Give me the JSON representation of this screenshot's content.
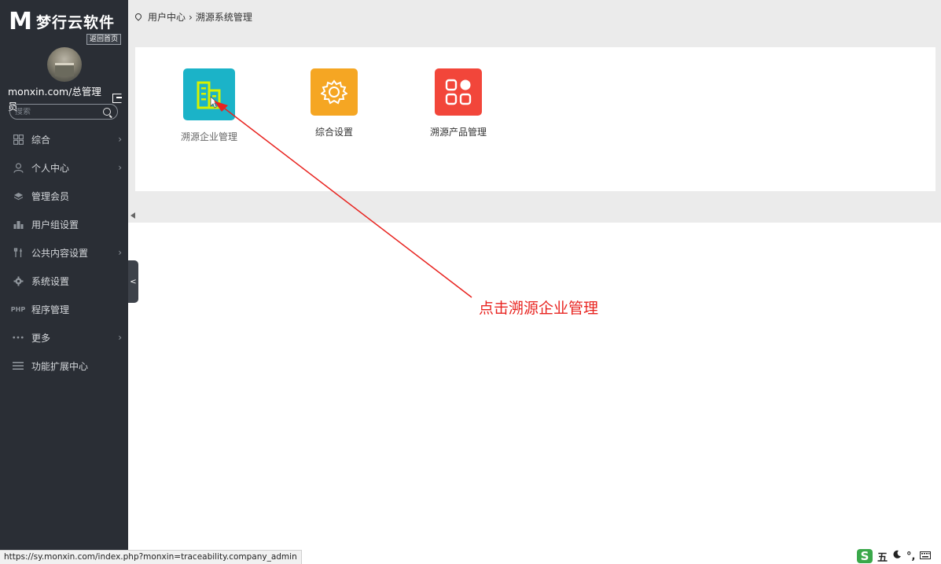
{
  "sidebar": {
    "brand_name": "梦行云软件",
    "brand_logo": "M",
    "back_home": "返回首页",
    "username": "monxin.com/总管理员",
    "search_placeholder": "搜索",
    "items": [
      {
        "label": "综合",
        "icon": "grid-icon",
        "has_submenu": true
      },
      {
        "label": "个人中心",
        "icon": "user-icon",
        "has_submenu": true
      },
      {
        "label": "管理会员",
        "icon": "layers-icon",
        "has_submenu": false
      },
      {
        "label": "用户组设置",
        "icon": "group-icon",
        "has_submenu": false
      },
      {
        "label": "公共内容设置",
        "icon": "tools-icon",
        "has_submenu": true
      },
      {
        "label": "系统设置",
        "icon": "gear-icon",
        "has_submenu": false
      },
      {
        "label": "程序管理",
        "icon": "php-icon",
        "icon_text": "PHP",
        "has_submenu": false
      },
      {
        "label": "更多",
        "icon": "dots-icon",
        "has_submenu": true
      },
      {
        "label": "功能扩展中心",
        "icon": "menu-icon",
        "has_submenu": false
      }
    ],
    "collapse_label": "<"
  },
  "breadcrumb": {
    "items": [
      "用户中心",
      "溯源系统管理"
    ],
    "separator": "›"
  },
  "tiles": [
    {
      "label": "溯源企业管理",
      "icon": "buildings-icon",
      "color": "#1bb3c8"
    },
    {
      "label": "综合设置",
      "icon": "gear-icon",
      "color": "#f5a623"
    },
    {
      "label": "溯源产品管理",
      "icon": "apps-icon",
      "color": "#f2463a"
    }
  ],
  "annotation": {
    "text": "点击溯源企业管理",
    "color": "#e8231f"
  },
  "status_bar": {
    "url": "https://sy.monxin.com/index.php?monxin=traceability.company_admin"
  },
  "ime": {
    "logo": "S",
    "mode": "五",
    "punct": "°,"
  }
}
